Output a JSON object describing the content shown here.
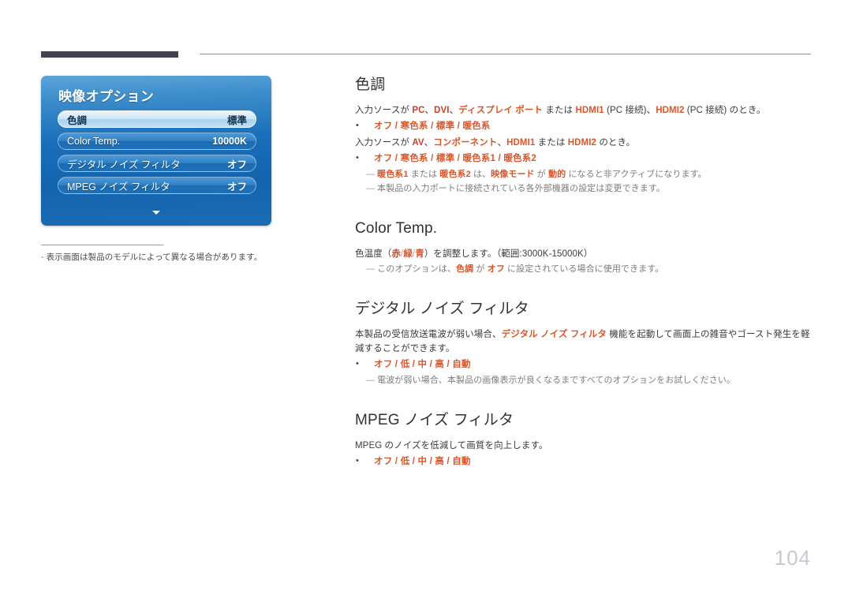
{
  "page": {
    "number": "104"
  },
  "osd": {
    "title": "映像オプション",
    "rows": [
      {
        "label": "色調",
        "value": "標準",
        "selected": true
      },
      {
        "label": "Color Temp.",
        "value": "10000K",
        "selected": false
      },
      {
        "label": "デジタル ノイズ フィルタ",
        "value": "オフ",
        "selected": false
      },
      {
        "label": "MPEG ノイズ フィルタ",
        "value": "オフ",
        "selected": false
      }
    ],
    "scroll_arrow": "down-arrow"
  },
  "left_note": {
    "dash": "-",
    "text": "表示画面は製品のモデルによって異なる場合があります。"
  },
  "sections": {
    "tint": {
      "heading": "色調",
      "line1": {
        "a": "入力ソースが ",
        "pc": "PC",
        "c1": "、",
        "dvi": "DVI",
        "c2": "、",
        "dp": "ディスプレイ ポート",
        "b": " または ",
        "hdmi1": "HDMI1",
        "hdmi1_suffix": " (PC 接続)",
        "c3": "、",
        "hdmi2": "HDMI2",
        "hdmi2_suffix": " (PC 接続)",
        "tail": " のとき。"
      },
      "options1": "オフ / 寒色系 / 標準 / 暖色系",
      "line2": {
        "a": "入力ソースが ",
        "av": "AV",
        "c1": "、",
        "comp": "コンポーネント",
        "c2": "、",
        "hdmi1": "HDMI1",
        "b": " または ",
        "hdmi2": "HDMI2",
        "tail": " のとき。"
      },
      "options2": "オフ / 寒色系 / 標準 / 暖色系1 / 暖色系2",
      "note1": {
        "emdash": "―",
        "t1": "暖色系1",
        "t2": " または ",
        "t3": "暖色系2",
        "t4": " は、",
        "t5": "映像モード",
        "t6": " が ",
        "t7": "動的",
        "t8": " になると非アクティブになります。"
      },
      "note2": {
        "emdash": "―",
        "text": "本製品の入力ポートに接続されている各外部機器の設定は変更できます。"
      }
    },
    "color_temp": {
      "heading": "Color Temp.",
      "line1": {
        "a": "色温度（",
        "red": "赤",
        "s1": "/",
        "green": "緑",
        "s2": "/",
        "blue": "青",
        "b": "）を調整します。（範囲:3000K-15000K）"
      },
      "note1": {
        "emdash": "―",
        "t1": "このオプションは、",
        "t2": "色調",
        "t3": " が ",
        "t4": "オフ",
        "t5": " に設定されている場合に使用できます。"
      }
    },
    "digital_noise_filter": {
      "heading": "デジタル ノイズ フィルタ",
      "line1": {
        "a": "本製品の受信放送電波が弱い場合、",
        "term": "デジタル ノイズ フィルタ",
        "b": " 機能を起動して画面上の雑音やゴースト発生を軽減することができます。"
      },
      "options": "オフ / 低 / 中 / 高 / 自動",
      "note1": {
        "emdash": "―",
        "text": "電波が弱い場合、本製品の画像表示が良くなるまですべてのオプションをお試しください。"
      }
    },
    "mpeg_noise_filter": {
      "heading": "MPEG ノイズ フィルタ",
      "line1": "MPEG のノイズを低減して画質を向上します。",
      "options": "オフ / 低 / 中 / 高 / 自動"
    }
  },
  "colors": {
    "accent_orange": "#d9562b",
    "accent_red": "#cf3e26",
    "osd_blue": "#1a6fb9",
    "rule_dark": "#45414f",
    "page_number": "#c9c8d2"
  }
}
